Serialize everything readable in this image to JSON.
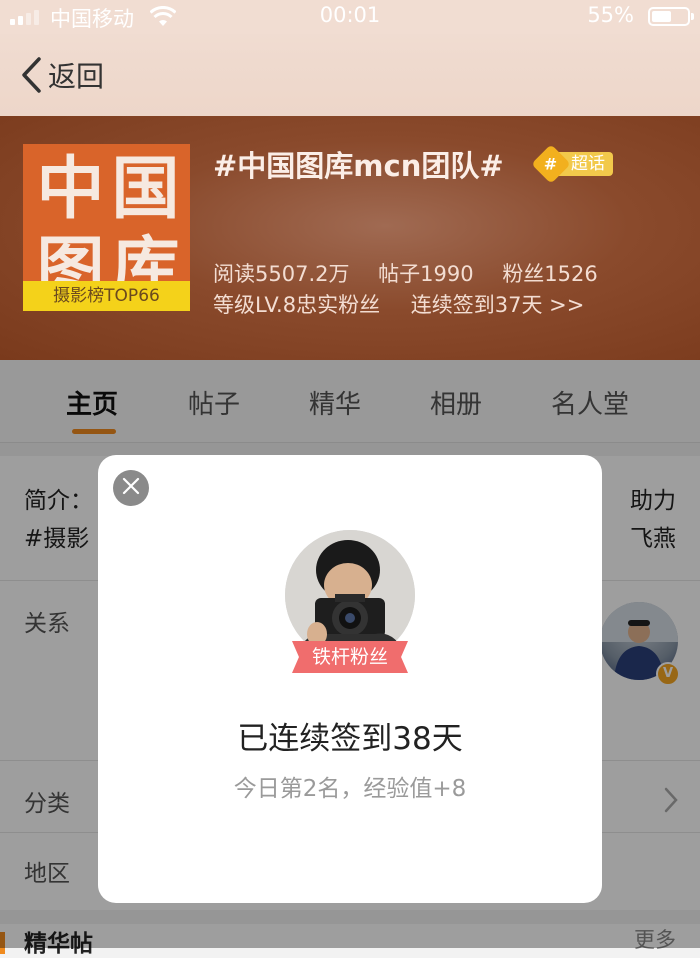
{
  "status_bar": {
    "carrier": "中国移动",
    "time": "00:01",
    "battery_percent": "55%",
    "battery_level": 0.55,
    "signal_bars": 2,
    "icons": [
      "signal-icon",
      "wifi-icon",
      "battery-icon"
    ]
  },
  "nav": {
    "back_label": "返回",
    "icons": [
      "chevron-left-icon"
    ]
  },
  "header": {
    "logo_text": [
      "中",
      "国",
      "图",
      "库"
    ],
    "logo_rank": "摄影榜TOP66",
    "title": "#中国图库mcn团队#",
    "super_badge_hash": "#",
    "super_badge_text": "超话",
    "stats": {
      "reads": "阅读5507.2万",
      "posts": "帖子1990",
      "fans": "粉丝1526"
    },
    "level": "等级LV.8忠实粉丝",
    "checkin_streak": "连续签到37天 >>"
  },
  "tabs": [
    {
      "label": "主页",
      "active": true
    },
    {
      "label": "帖子",
      "active": false
    },
    {
      "label": "精华",
      "active": false
    },
    {
      "label": "相册",
      "active": false
    },
    {
      "label": "名人堂",
      "active": false
    }
  ],
  "content": {
    "intro_left_1": "简介：",
    "intro_right_1": "助力",
    "intro_left_2": "#摄影",
    "intro_right_2": "飞燕",
    "relation_label": "关系",
    "category_label": "分类",
    "region_label": "地区",
    "section_title": "精华帖",
    "section_more": "更多",
    "verified_badge": "V"
  },
  "modal": {
    "fan_badge": "铁杆粉丝",
    "title": "已连续签到38天",
    "subtitle": "今日第2名，经验值+8"
  },
  "colors": {
    "accent": "#f08b1f",
    "banner": "#8a4a2c",
    "fan_badge": "#f06d6d",
    "super_badge": "#f2b01e"
  }
}
